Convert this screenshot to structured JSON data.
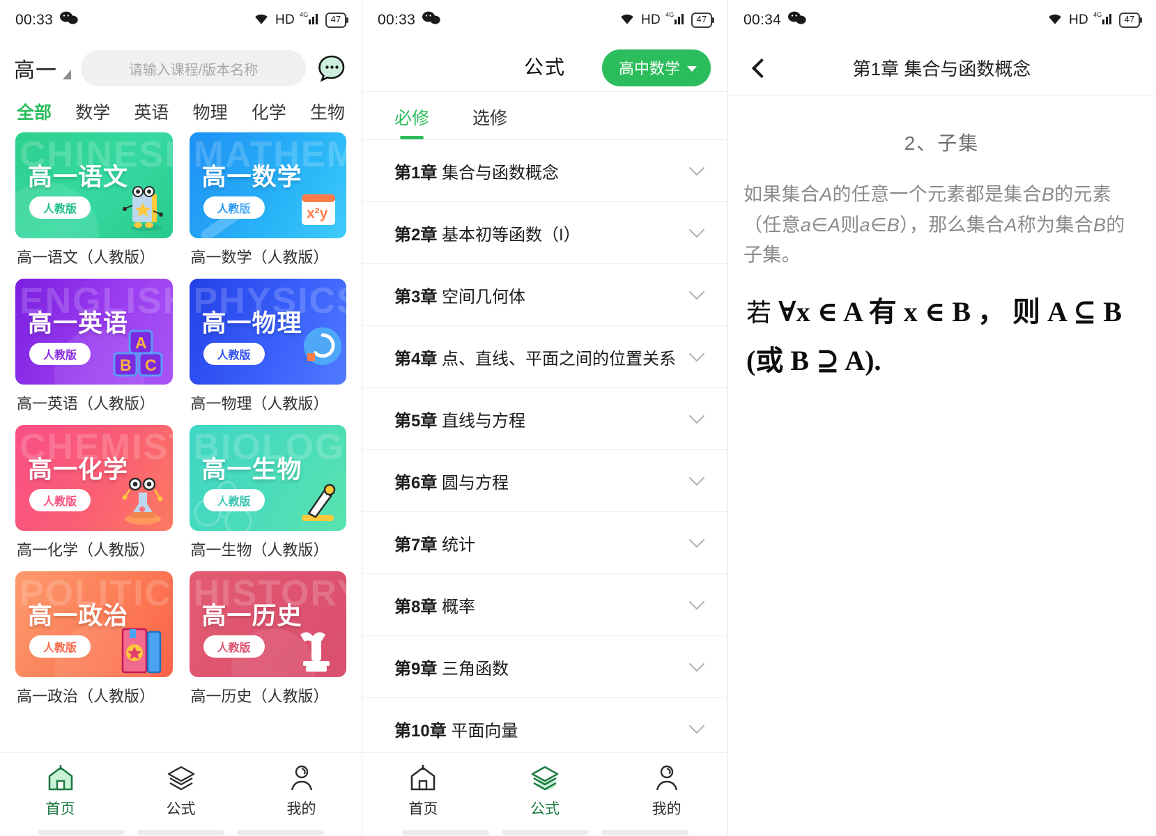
{
  "panel1": {
    "status": {
      "time": "00:33",
      "hd": "HD",
      "battery": "47",
      "network": "4G"
    },
    "grade_label": "高一",
    "search_placeholder": "请输入课程/版本名称",
    "chat_icon": "chat-bubble-icon",
    "subject_tabs": [
      {
        "label": "全部",
        "active": true
      },
      {
        "label": "数学",
        "active": false
      },
      {
        "label": "英语",
        "active": false
      },
      {
        "label": "物理",
        "active": false
      },
      {
        "label": "化学",
        "active": false
      },
      {
        "label": "生物",
        "active": false
      }
    ],
    "cards": [
      {
        "title": "高一语文",
        "badge": "人教版",
        "caption": "高一语文（人教版）",
        "watermark": "CHINESE",
        "c1": "#2ed08f",
        "c2": "#3ddca3",
        "deco": "book-mascot-icon"
      },
      {
        "title": "高一数学",
        "badge": "人教版",
        "caption": "高一数学（人教版）",
        "watermark": "MATHEMATICS",
        "c1": "#2196f3",
        "c2": "#36c6f4",
        "deco": "calculator-icon"
      },
      {
        "title": "高一英语",
        "badge": "人教版",
        "caption": "高一英语（人教版）",
        "watermark": "ENGLISH",
        "c1": "#8a2be2",
        "c2": "#9a45f0",
        "deco": "abc-blocks-icon"
      },
      {
        "title": "高一物理",
        "badge": "人教版",
        "caption": "高一物理（人教版）",
        "watermark": "PHYSICS",
        "c1": "#2d4ef5",
        "c2": "#4f7bff",
        "deco": "magnet-icon"
      },
      {
        "title": "高一化学",
        "badge": "人教版",
        "caption": "高一化学（人教版）",
        "watermark": "CHEMISTRY",
        "c1": "#f9507f",
        "c2": "#fb6a62",
        "deco": "flask-mascot-icon"
      },
      {
        "title": "高一生物",
        "badge": "人教版",
        "caption": "高一生物（人教版）",
        "watermark": "BIOLOGY",
        "c1": "#3fd6c5",
        "c2": "#57e0b9",
        "deco": "microscope-icon"
      },
      {
        "title": "高一政治",
        "badge": "人教版",
        "caption": "高一政治（人教版）",
        "watermark": "POLITICS",
        "c1": "#fd8a62",
        "c2": "#fc6a4e",
        "deco": "books-icon"
      },
      {
        "title": "高一历史",
        "badge": "人教版",
        "caption": "高一历史（人教版）",
        "watermark": "HISTORY",
        "c1": "#e0566f",
        "c2": "#d9506c",
        "deco": "statue-icon"
      }
    ],
    "nav": [
      {
        "label": "首页",
        "icon": "home-icon",
        "active": true
      },
      {
        "label": "公式",
        "icon": "layers-icon",
        "active": false
      },
      {
        "label": "我的",
        "icon": "user-icon",
        "active": false
      }
    ]
  },
  "panel2": {
    "status": {
      "time": "00:33",
      "hd": "HD",
      "battery": "47",
      "network": "4G"
    },
    "title": "公式",
    "subject_pill": "高中数学",
    "tabs": [
      {
        "label": "必修",
        "active": true
      },
      {
        "label": "选修",
        "active": false
      }
    ],
    "chapters": [
      {
        "num": "第1章",
        "name": "集合与函数概念"
      },
      {
        "num": "第2章",
        "name": "基本初等函数（I）"
      },
      {
        "num": "第3章",
        "name": "空间几何体"
      },
      {
        "num": "第4章",
        "name": "点、直线、平面之间的位置关系"
      },
      {
        "num": "第5章",
        "name": "直线与方程"
      },
      {
        "num": "第6章",
        "name": "圆与方程"
      },
      {
        "num": "第7章",
        "name": "统计"
      },
      {
        "num": "第8章",
        "name": "概率"
      },
      {
        "num": "第9章",
        "name": "三角函数"
      },
      {
        "num": "第10章",
        "name": "平面向量"
      }
    ],
    "nav": [
      {
        "label": "首页",
        "icon": "home-icon",
        "active": false
      },
      {
        "label": "公式",
        "icon": "layers-icon",
        "active": true
      },
      {
        "label": "我的",
        "icon": "user-icon",
        "active": false
      }
    ]
  },
  "panel3": {
    "status": {
      "time": "00:34",
      "hd": "HD",
      "battery": "47",
      "network": "4G"
    },
    "back_icon": "back-chevron-icon",
    "title": "第1章 集合与函数概念",
    "section_title": "2、子集",
    "body_line1": "如果集合",
    "body_italicA": "A",
    "body_line2": "的任意一个元素都是集合",
    "body_italicB": "B",
    "body_line3": "的元素（任意",
    "body_aA": "a∈A",
    "body_line4": "则",
    "body_aB": "a∈B",
    "body_line5": "），那么集合",
    "body_italicA2": "A",
    "body_line6": "称为集合",
    "body_italicB2": "B",
    "body_line7": "的子集。",
    "formula_prefix": "若",
    "formula_main": "∀x ∈ A 有 x ∈ B ， 则 A ⊆ B",
    "formula_tail": "(或 B ⊇ A)."
  },
  "colors": {
    "accent_green": "#2bbd5c",
    "text_primary": "#1a1a1a",
    "text_secondary": "#8a8a8a",
    "divider": "#f1f1f1"
  }
}
